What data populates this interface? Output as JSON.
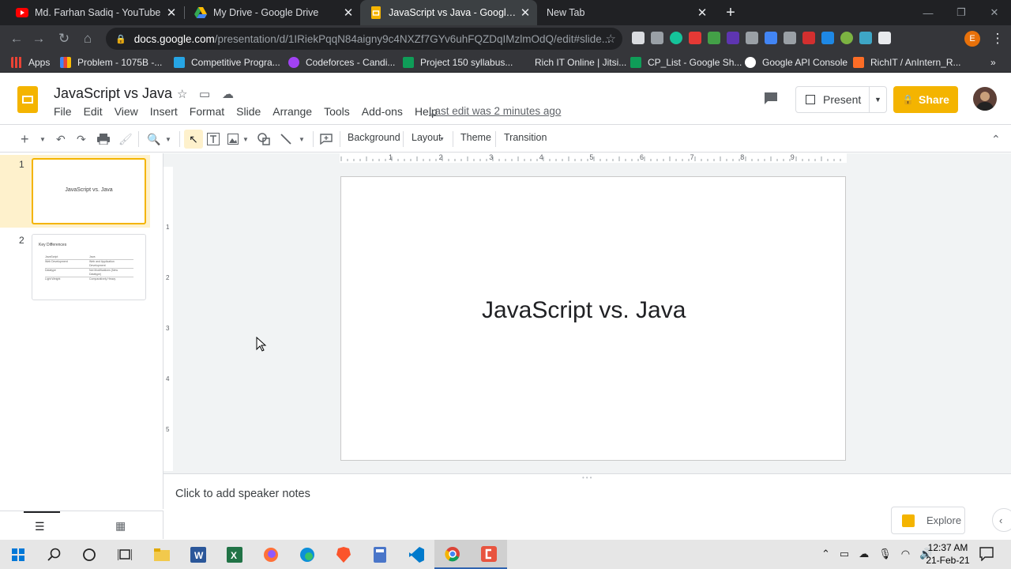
{
  "browser": {
    "tabs": [
      {
        "title": "Md. Farhan Sadiq - YouTube",
        "favicon": "youtube-icon",
        "active": false
      },
      {
        "title": "My Drive - Google Drive",
        "favicon": "google-drive-icon",
        "active": false
      },
      {
        "title": "JavaScript vs Java - Google Slides",
        "favicon": "google-slides-icon",
        "active": true
      },
      {
        "title": "New Tab",
        "favicon": "",
        "active": false
      }
    ],
    "new_tab_label": "+",
    "url_host": "docs.google.com",
    "url_path": "/presentation/d/1IRiekPqqN84aigny9c4NXZf7GYv6uhFQZDqIMzlmOdQ/edit#slide...",
    "bookmarks": [
      {
        "label": "Apps",
        "icon": "apps-grid-icon"
      },
      {
        "label": "Problem - 1075B -...",
        "icon": "bar-chart-icon"
      },
      {
        "label": "Competitive Progra...",
        "icon": "presentation-icon"
      },
      {
        "label": "Codeforces - Candi...",
        "icon": "m-icon"
      },
      {
        "label": "Project 150 syllabus...",
        "icon": "sheets-icon"
      },
      {
        "label": "Rich IT Online | Jitsi...",
        "icon": ""
      },
      {
        "label": "CP_List - Google Sh...",
        "icon": "sheets-icon"
      },
      {
        "label": "Google API Console",
        "icon": "google-icon"
      },
      {
        "label": "RichIT / AnIntern_R...",
        "icon": "gitlab-icon"
      }
    ],
    "profile_initial": "E"
  },
  "slides": {
    "doc_title": "JavaScript vs Java",
    "menu": [
      "File",
      "Edit",
      "View",
      "Insert",
      "Format",
      "Slide",
      "Arrange",
      "Tools",
      "Add-ons",
      "Help"
    ],
    "last_edit": "Last edit was 2 minutes ago",
    "present_label": "Present",
    "share_label": "Share",
    "toolbar": {
      "background_label": "Background",
      "layout_label": "Layout",
      "theme_label": "Theme",
      "transition_label": "Transition"
    },
    "ruler_marks": [
      "1",
      "2",
      "3",
      "4",
      "5",
      "6",
      "7",
      "8",
      "9"
    ],
    "vruler_marks": [
      "1",
      "2",
      "3",
      "4",
      "5"
    ],
    "filmstrip": [
      {
        "number": "1",
        "title": "JavaScript vs. Java"
      },
      {
        "number": "2",
        "title": "Key Differences",
        "table": [
          [
            "JavaScript",
            "Java"
          ],
          [
            "Web Development",
            "Web and Application Development"
          ],
          [
            "Datatype",
            "Not Modifications (New Datatype)"
          ],
          [
            "Light Weight",
            "Comparatively Heavy"
          ]
        ]
      }
    ],
    "current_slide_title": "JavaScript vs. Java",
    "speaker_notes_placeholder": "Click to add speaker notes",
    "explore_label": "Explore"
  },
  "taskbar": {
    "time": "12:37 AM",
    "date": "21-Feb-21"
  },
  "colors": {
    "slides_yellow": "#f4b400",
    "chrome_dark": "#202124",
    "filmstrip_selected": "#fef1cc"
  }
}
